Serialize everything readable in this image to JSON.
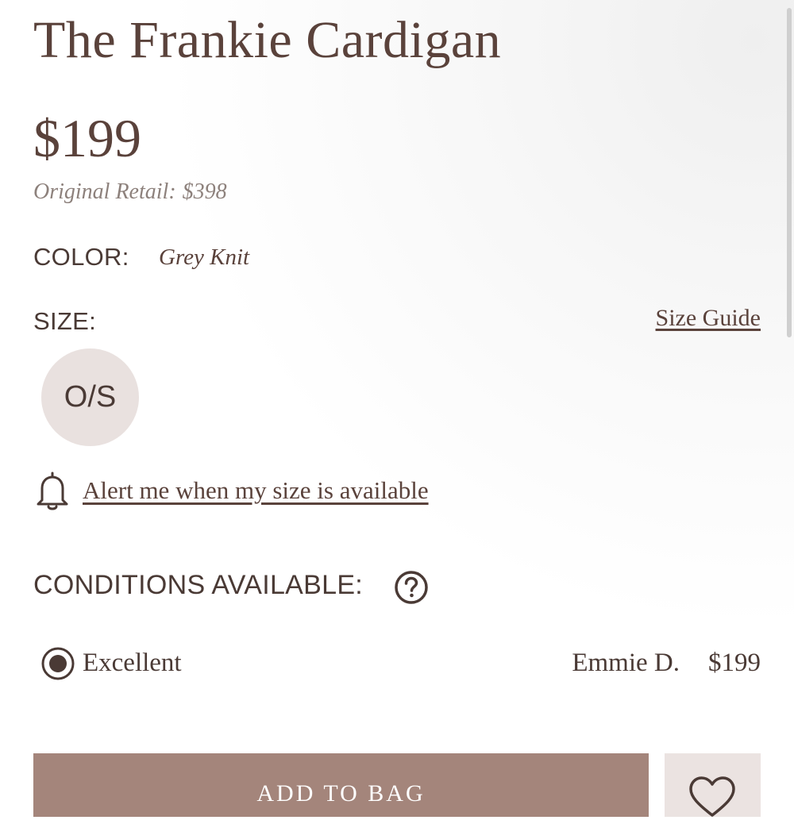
{
  "product": {
    "title": "The Frankie Cardigan",
    "price": "$199",
    "original_retail_label": "Original Retail:",
    "original_retail_price": "$398"
  },
  "color": {
    "label": "COLOR:",
    "value": "Grey Knit"
  },
  "size": {
    "label": "SIZE:",
    "guide_link": "Size Guide",
    "options": [
      "O/S"
    ],
    "selected": "O/S"
  },
  "alert": {
    "icon": "bell-icon",
    "text": "Alert me when my size is available"
  },
  "conditions": {
    "label": "CONDITIONS AVAILABLE:",
    "help_icon": "question-circle-icon",
    "options": [
      {
        "name": "Excellent",
        "seller": "Emmie D.",
        "price": "$199",
        "selected": true
      }
    ]
  },
  "actions": {
    "add_to_bag": "ADD TO BAG",
    "wishlist_icon": "heart-icon"
  },
  "colors": {
    "text": "#5a423b",
    "accent_button": "#a4857b",
    "chip_bg": "#e9e1df",
    "muted_text": "#8d817c"
  }
}
